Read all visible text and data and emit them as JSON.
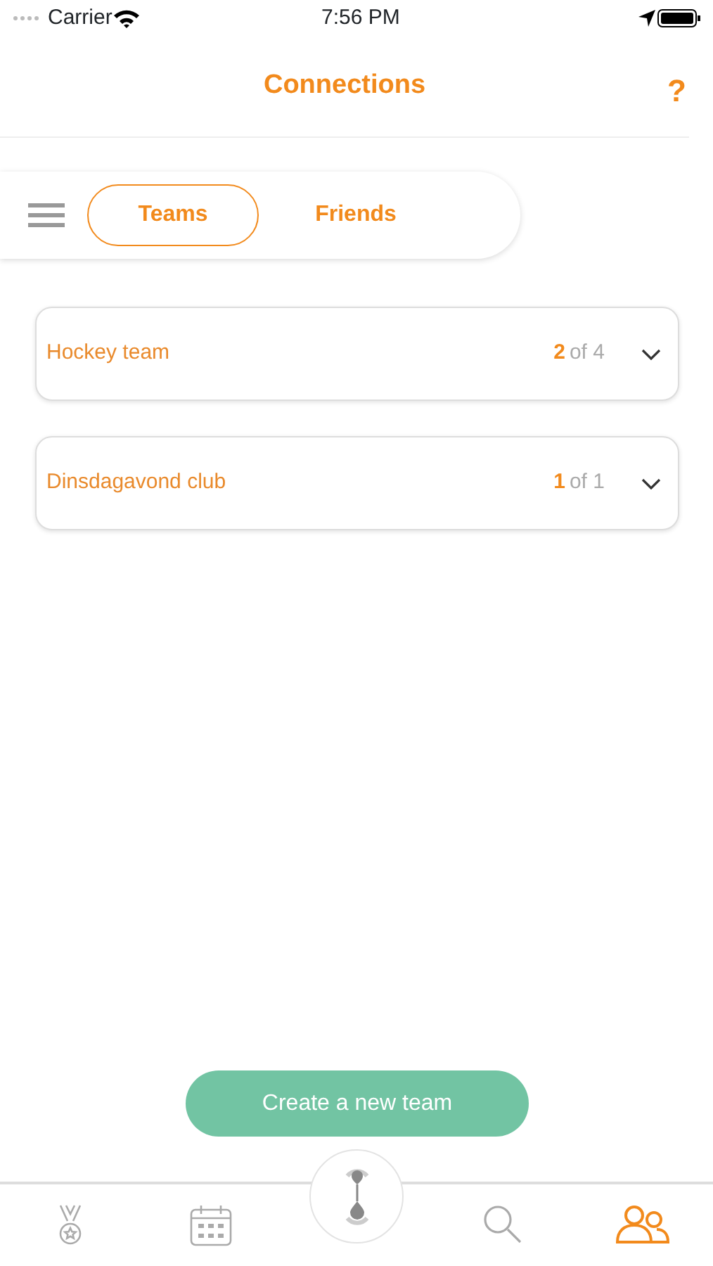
{
  "status_bar": {
    "carrier": "Carrier",
    "time": "7:56 PM"
  },
  "header": {
    "title": "Connections",
    "help": "?"
  },
  "segments": [
    {
      "label": "Teams",
      "selected": true
    },
    {
      "label": "Friends",
      "selected": false
    }
  ],
  "teams": [
    {
      "name": "Hockey team",
      "count": "2",
      "total": "of 4"
    },
    {
      "name": "Dinsdagavond club",
      "count": "1",
      "total": "of 1"
    }
  ],
  "create_button": "Create a new team",
  "tab_bar": [
    {
      "kind": "medal",
      "selected": false
    },
    {
      "kind": "calendar",
      "selected": false
    },
    {
      "kind": "logo",
      "selected": false
    },
    {
      "kind": "search",
      "selected": false
    },
    {
      "kind": "people",
      "selected": true
    }
  ]
}
